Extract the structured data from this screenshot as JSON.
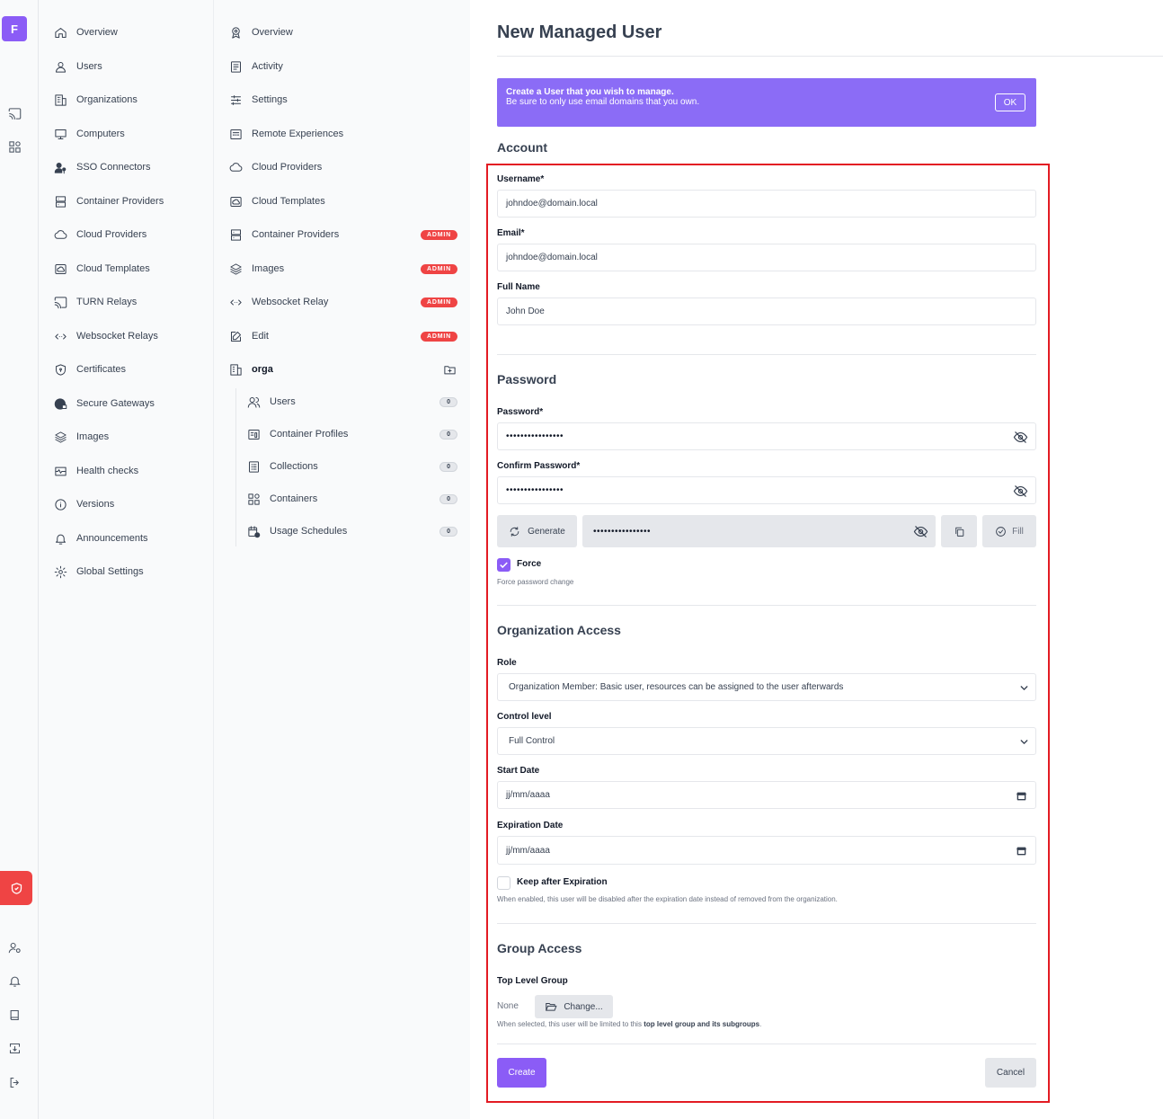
{
  "app": {
    "logo_text": "F",
    "accent_color": "#8b5cf6",
    "danger_color": "#ef4444"
  },
  "rail": {
    "icons": [
      "cast-icon",
      "apps-icon",
      "shield-icon",
      "users-cog-icon",
      "bell-icon",
      "book-icon",
      "download-icon",
      "logout-icon"
    ]
  },
  "nav1": {
    "items": [
      {
        "label": "Overview",
        "icon": "home-icon"
      },
      {
        "label": "Users",
        "icon": "user-icon"
      },
      {
        "label": "Organizations",
        "icon": "building-icon"
      },
      {
        "label": "Computers",
        "icon": "monitor-icon"
      },
      {
        "label": "SSO Connectors",
        "icon": "user-key-icon"
      },
      {
        "label": "Container Providers",
        "icon": "server-icon"
      },
      {
        "label": "Cloud Providers",
        "icon": "cloud-icon"
      },
      {
        "label": "Cloud Templates",
        "icon": "cloud-template-icon"
      },
      {
        "label": "TURN Relays",
        "icon": "cast-icon"
      },
      {
        "label": "Websocket Relays",
        "icon": "code-arrows-icon"
      },
      {
        "label": "Certificates",
        "icon": "shield-lock-icon"
      },
      {
        "label": "Secure Gateways",
        "icon": "globe-lock-icon"
      },
      {
        "label": "Images",
        "icon": "layers-icon"
      },
      {
        "label": "Health checks",
        "icon": "pulse-icon"
      },
      {
        "label": "Versions",
        "icon": "info-icon"
      },
      {
        "label": "Announcements",
        "icon": "bell-icon"
      },
      {
        "label": "Global Settings",
        "icon": "gear-icon"
      }
    ]
  },
  "nav2": {
    "admin_badge": "ADMIN",
    "items": [
      {
        "label": "Overview",
        "icon": "badge-icon"
      },
      {
        "label": "Activity",
        "icon": "list-icon"
      },
      {
        "label": "Settings",
        "icon": "sliders-icon"
      },
      {
        "label": "Remote Experiences",
        "icon": "window-icon"
      },
      {
        "label": "Cloud Providers",
        "icon": "cloud-icon"
      },
      {
        "label": "Cloud Templates",
        "icon": "cloud-template-icon"
      },
      {
        "label": "Container Providers",
        "icon": "server-icon",
        "admin": true
      },
      {
        "label": "Images",
        "icon": "layers-icon",
        "admin": true
      },
      {
        "label": "Websocket Relay",
        "icon": "code-arrows-icon",
        "admin": true
      },
      {
        "label": "Edit",
        "icon": "edit-icon",
        "admin": true
      }
    ],
    "org": {
      "label": "orga",
      "icon": "building-icon"
    },
    "sub_items": [
      {
        "label": "Users",
        "count": "0",
        "icon": "users-icon"
      },
      {
        "label": "Container Profiles",
        "count": "0",
        "icon": "profile-icon"
      },
      {
        "label": "Collections",
        "count": "0",
        "icon": "collection-icon"
      },
      {
        "label": "Containers",
        "count": "0",
        "icon": "apps-icon"
      },
      {
        "label": "Usage Schedules",
        "count": "0",
        "icon": "calendar-clock-icon"
      }
    ]
  },
  "page": {
    "title": "New Managed User",
    "banner": {
      "line1": "Create a User that you wish to manage.",
      "line2": "Be sure to only use email domains that you own.",
      "ok": "OK"
    }
  },
  "account": {
    "heading": "Account",
    "username_label": "Username*",
    "username_value": "johndoe@domain.local",
    "email_label": "Email*",
    "email_value": "johndoe@domain.local",
    "fullname_label": "Full Name",
    "fullname_value": "John Doe"
  },
  "password": {
    "heading": "Password",
    "password_label": "Password*",
    "password_value": "••••••••••••••••",
    "confirm_label": "Confirm Password*",
    "confirm_value": "••••••••••••••••",
    "generate_label": "Generate",
    "generated_value": "••••••••••••••••",
    "fill_label": "Fill",
    "force_label": "Force",
    "force_checked": true,
    "force_hint": "Force password change"
  },
  "org_access": {
    "heading": "Organization Access",
    "role_label": "Role",
    "role_value": "Organization Member: Basic user, resources can be assigned to the user afterwards",
    "control_label": "Control level",
    "control_value": "Full Control",
    "start_label": "Start Date",
    "start_placeholder": "jj/mm/aaaa",
    "expiration_label": "Expiration Date",
    "expiration_placeholder": "jj/mm/aaaa",
    "keep_label": "Keep after Expiration",
    "keep_checked": false,
    "keep_hint": "When enabled, this user will be disabled after the expiration date instead of removed from the organization."
  },
  "group_access": {
    "heading": "Group Access",
    "top_level_label": "Top Level Group",
    "value": "None",
    "change_label": "Change...",
    "hint_prefix": "When selected, this user will be limited to this ",
    "hint_bold": "top level group and its subgroups",
    "hint_suffix": "."
  },
  "actions": {
    "create": "Create",
    "cancel": "Cancel"
  }
}
